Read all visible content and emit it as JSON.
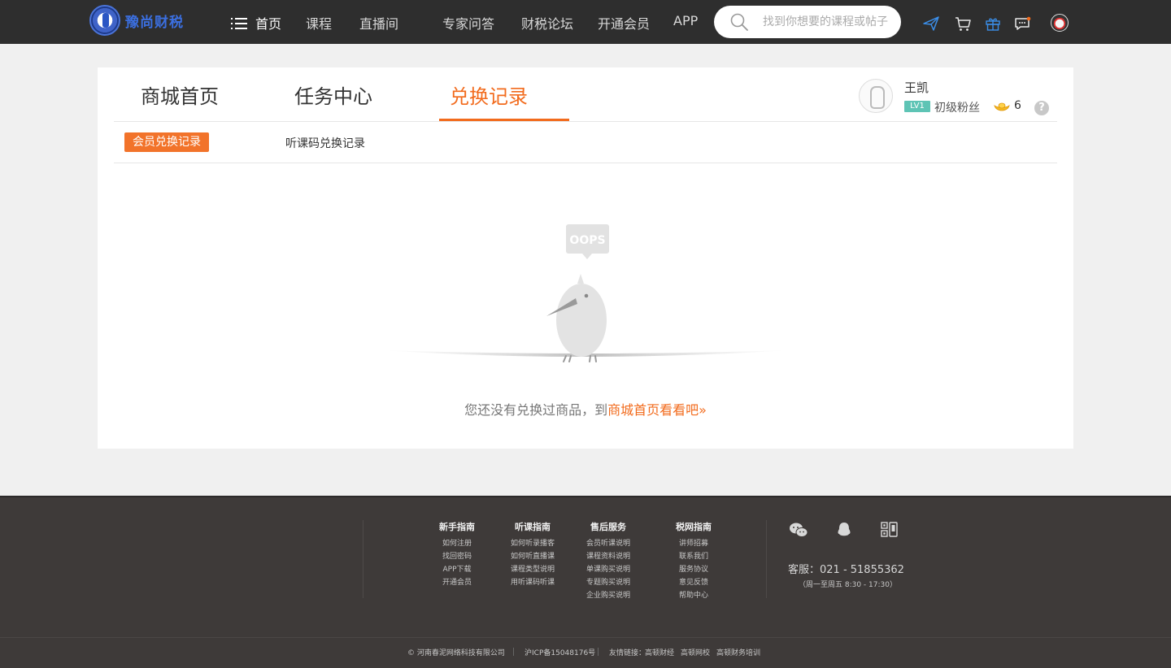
{
  "brand": {
    "name": "豫尚财税"
  },
  "nav": {
    "home": "首页",
    "courses": "课程",
    "live": "直播间",
    "expert_qa": "专家问答",
    "forum": "财税论坛",
    "vip": "开通会员",
    "app": "APP"
  },
  "search": {
    "placeholder": "找到你想要的课程或帖子"
  },
  "tabs": {
    "mall_home": "商城首页",
    "task_center": "任务中心",
    "exchange_records": "兑换记录"
  },
  "user": {
    "name": "王凯",
    "level": "LV1",
    "level_title": "初级粉丝",
    "coins": "6",
    "help": "?"
  },
  "subtabs": {
    "member_exchange": "会员兑换记录",
    "code_exchange": "听课码兑换记录"
  },
  "empty": {
    "oops": "OOPS",
    "message": "您还没有兑换过商品，到",
    "link": "商城首页看看吧»"
  },
  "footer": {
    "columns": [
      {
        "title": "新手指南",
        "links": [
          "如何注册",
          "找回密码",
          "APP下载",
          "开通会员"
        ]
      },
      {
        "title": "听课指南",
        "links": [
          "如何听录播客",
          "如何听直播课",
          "课程类型说明",
          "用听课码听课"
        ]
      },
      {
        "title": "售后服务",
        "links": [
          "会员听课说明",
          "课程资料说明",
          "单课购买说明",
          "专题购买说明",
          "企业购买说明"
        ]
      },
      {
        "title": "税网指南",
        "links": [
          "讲师招募",
          "联系我们",
          "服务协议",
          "意见反馈",
          "帮助中心"
        ]
      }
    ],
    "phone": "客服：021 - 51855362",
    "hours": "（周一至周五  8:30 - 17:30）",
    "company": "© 河南春泥网络科技有限公司",
    "icp": "沪ICP备15048176号",
    "friend_links_label": "友情链接：",
    "friend_links": [
      "高顿财经",
      "高顿网校",
      "高顿财务培训"
    ]
  },
  "colors": {
    "accent": "#f26b1d",
    "topbar": "#2e2e2e",
    "footer": "#3e3a39",
    "level_badge": "#5ec4b5"
  }
}
